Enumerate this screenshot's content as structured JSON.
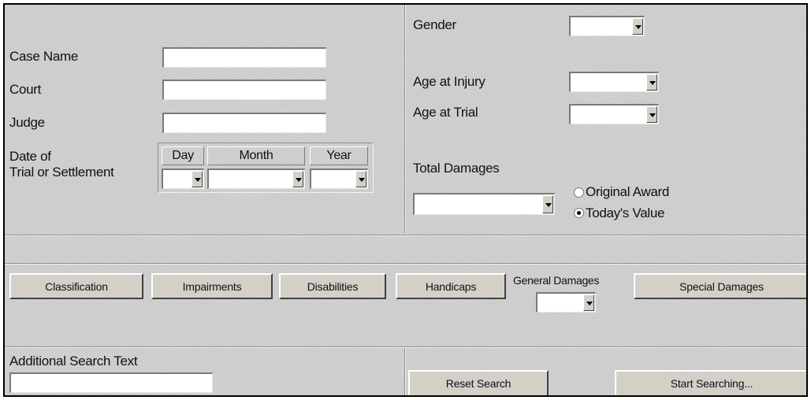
{
  "case_name": {
    "label": "Case Name",
    "value": ""
  },
  "court": {
    "label": "Court",
    "value": ""
  },
  "judge": {
    "label": "Judge",
    "value": ""
  },
  "date": {
    "label_line1": "Date of",
    "label_line2": "Trial or Settlement",
    "day_header": "Day",
    "month_header": "Month",
    "year_header": "Year",
    "day_value": "",
    "month_value": "",
    "year_value": ""
  },
  "gender": {
    "label": "Gender",
    "value": ""
  },
  "age_at_injury": {
    "label": "Age at Injury",
    "value": ""
  },
  "age_at_trial": {
    "label": "Age at Trial",
    "value": ""
  },
  "total_damages": {
    "label": "Total Damages",
    "value": "",
    "options": [
      {
        "label": "Original Award",
        "selected": false
      },
      {
        "label": "Today's Value",
        "selected": true
      }
    ]
  },
  "buttons": {
    "classification": "Classification",
    "impairments": "Impairments",
    "disabilities": "Disabilities",
    "handicaps": "Handicaps",
    "special_damages": "Special Damages",
    "reset_search": "Reset Search",
    "start_searching": "Start Searching..."
  },
  "general_damages": {
    "label": "General Damages",
    "value": ""
  },
  "additional_search": {
    "label": "Additional Search Text",
    "value": ""
  },
  "colors": {
    "panel": "#d2d2d2",
    "button_face": "#d4d0c8",
    "field": "#ffffff",
    "border": "#000000"
  }
}
